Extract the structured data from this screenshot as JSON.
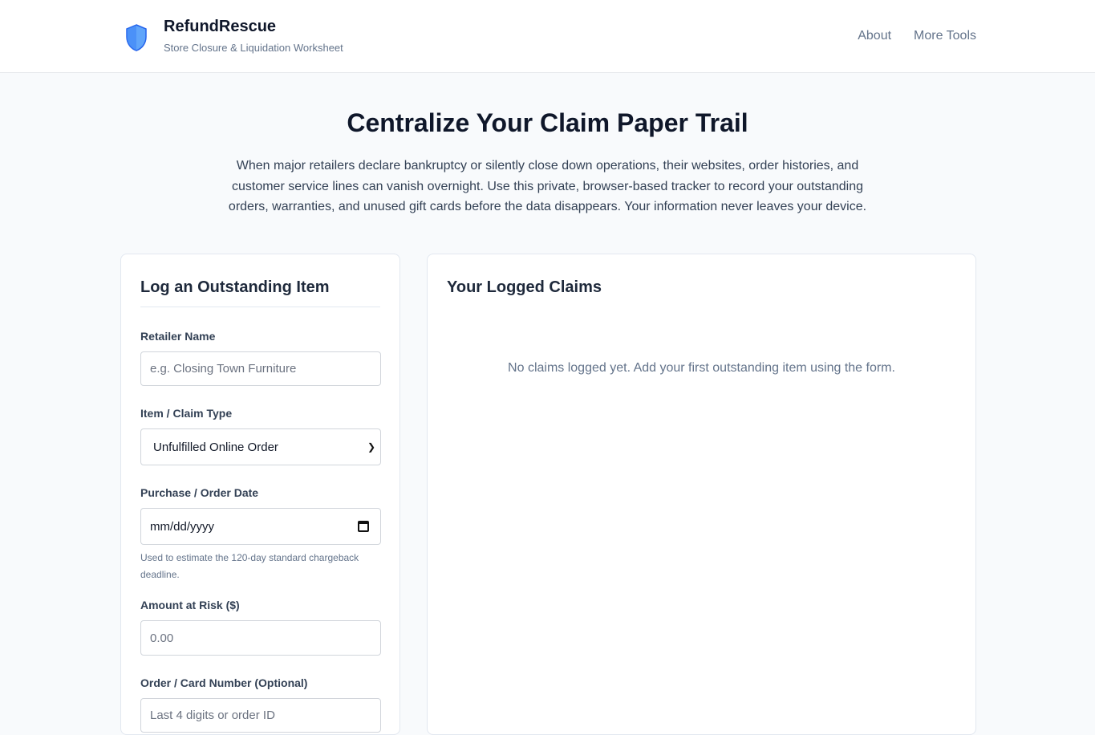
{
  "header": {
    "brand_name": "RefundRescue",
    "brand_subtitle": "Store Closure & Liquidation Worksheet",
    "nav": [
      "About",
      "More Tools"
    ]
  },
  "hero": {
    "title": "Centralize Your Claim Paper Trail",
    "description": "When major retailers declare bankruptcy or silently close down operations, their websites, order histories, and customer service lines can vanish overnight. Use this private, browser-based tracker to record your outstanding orders, warranties, and unused gift cards before the data disappears. Your information never leaves your device."
  },
  "form": {
    "title": "Log an Outstanding Item",
    "retailer": {
      "label": "Retailer Name",
      "placeholder": "e.g. Closing Town Furniture"
    },
    "claim_type": {
      "label": "Item / Claim Type",
      "selected": "Unfulfilled Online Order"
    },
    "date": {
      "label": "Purchase / Order Date",
      "placeholder": "mm/dd/yyyy",
      "hint": "Used to estimate the 120-day standard chargeback deadline."
    },
    "amount": {
      "label": "Amount at Risk ($)",
      "placeholder": "0.00"
    },
    "order_number": {
      "label": "Order / Card Number (Optional)",
      "placeholder": "Last 4 digits or order ID"
    }
  },
  "claims": {
    "title": "Your Logged Claims",
    "empty_message": "No claims logged yet. Add your first outstanding item using the form."
  },
  "colors": {
    "shield": "#60a5fa",
    "shield_dark": "#2563eb"
  },
  "icons": {
    "brand": "shield-icon",
    "select": "chevron-down-icon",
    "date": "calendar-icon"
  }
}
